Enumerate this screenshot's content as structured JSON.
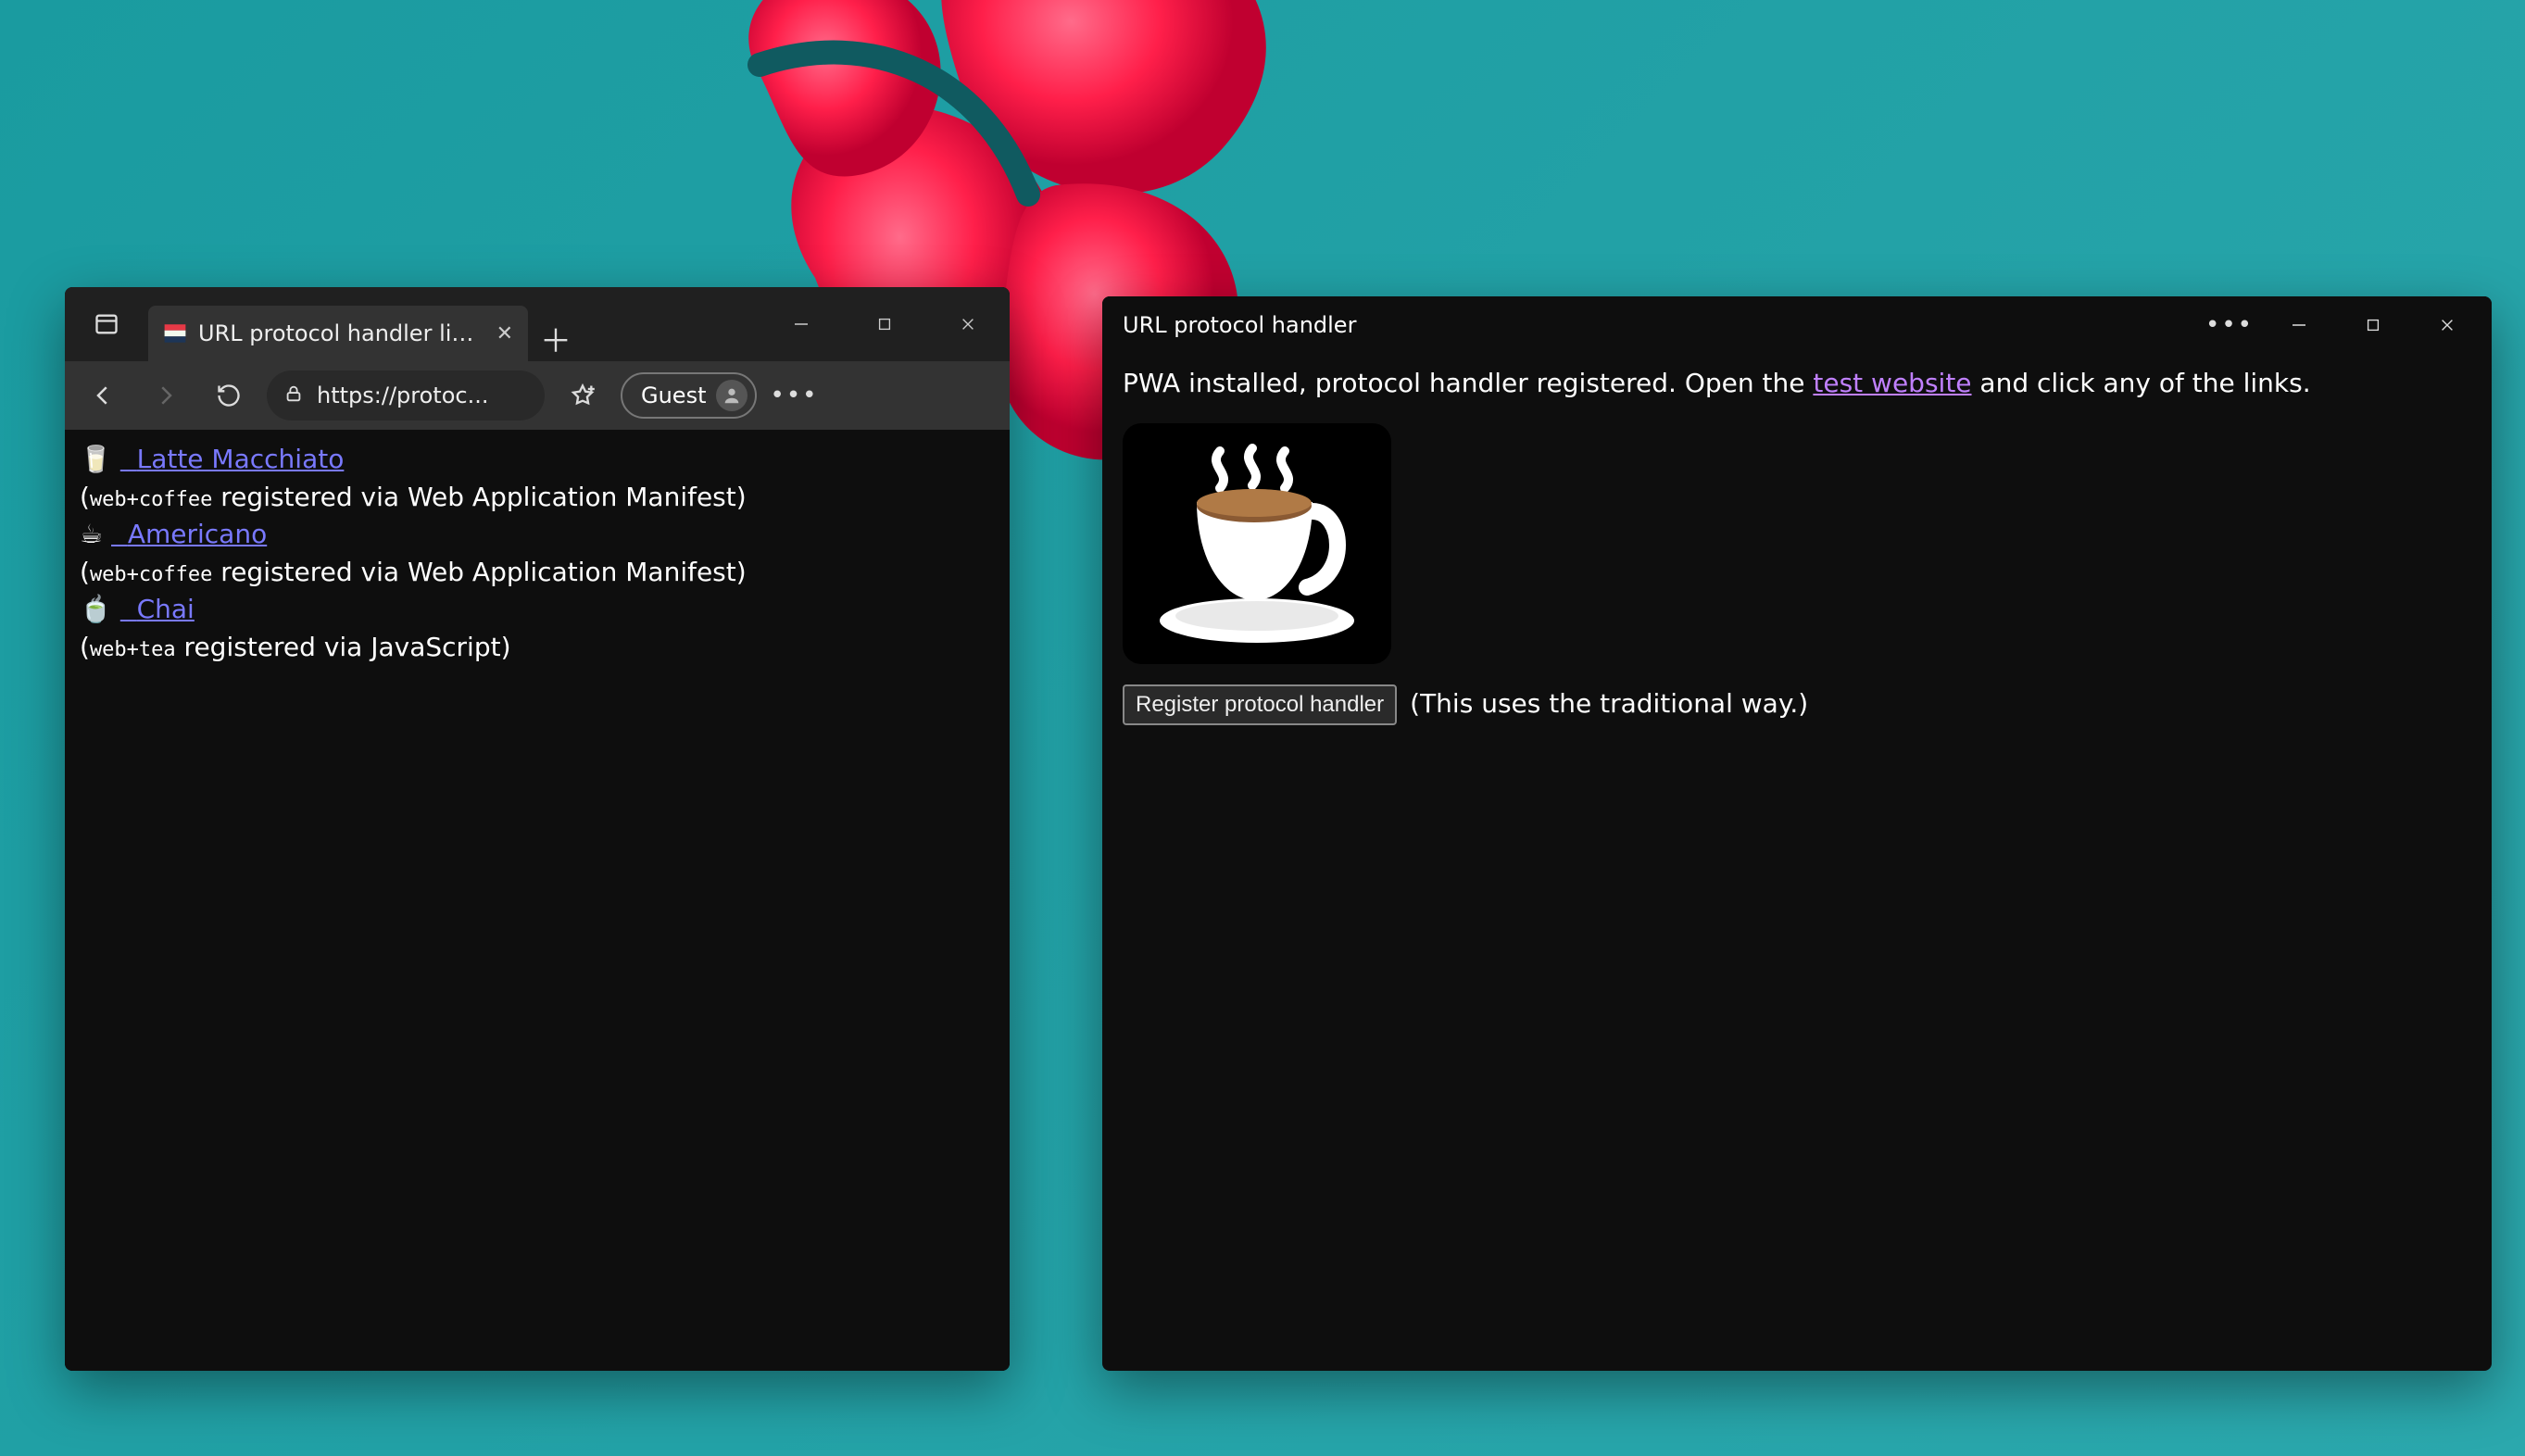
{
  "desktop": {
    "backgroundHint": "teal wallpaper with red flower"
  },
  "browserWindow": {
    "tab": {
      "title": "URL protocol handler links"
    },
    "toolbar": {
      "urlDisplay": "https://protoc...",
      "profileLabel": "Guest"
    },
    "page": {
      "links": [
        {
          "emoji": "🥛",
          "label": "Latte Macchiato",
          "note_protocol": "web+coffee",
          "note_text": " registered via Web Application Manifest)"
        },
        {
          "emoji": "☕",
          "label": "Americano",
          "note_protocol": "web+coffee",
          "note_text": " registered via Web Application Manifest)"
        },
        {
          "emoji": "🍵",
          "label": "Chai",
          "note_protocol": "web+tea",
          "note_text": " registered via JavaScript)"
        }
      ]
    }
  },
  "pwaWindow": {
    "title": "URL protocol handler",
    "body": {
      "textBefore": "PWA installed, protocol handler registered. Open the ",
      "linkText": "test website",
      "textAfter": " and click any of the links."
    },
    "registerButton": "Register protocol handler",
    "registerHint": "(This uses the traditional way.)"
  }
}
